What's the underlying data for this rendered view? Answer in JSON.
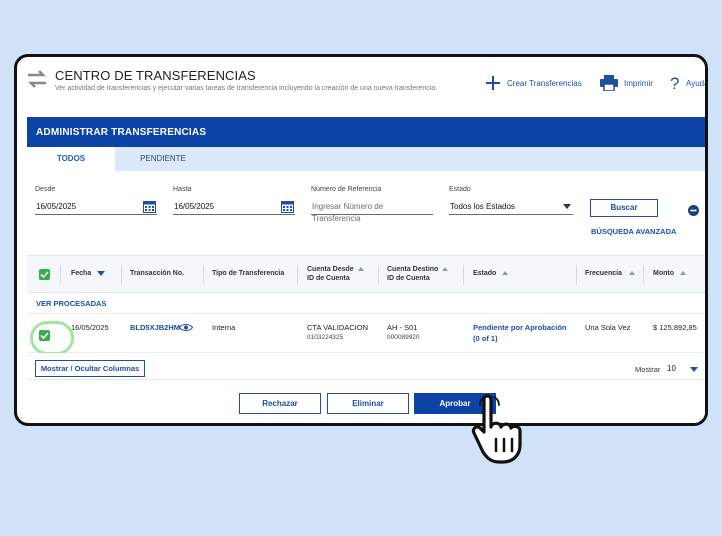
{
  "app": {
    "title": "CENTRO DE TRANSFERENCIAS",
    "subtitle": "Ver actividad de transferencias y ejecutar varias tareas de transferencia incluyendo la creación de una nueva transferencia.",
    "actions": {
      "create": "Crear Transferencias",
      "print": "Imprimir",
      "help": "Ayuda"
    }
  },
  "panel": {
    "title": "ADMINISTRAR TRANSFERENCIAS",
    "tabs": [
      {
        "label": "TODOS",
        "active": true
      },
      {
        "label": "PENDIENTE",
        "active": false
      }
    ]
  },
  "filters": {
    "from": {
      "label": "Desde",
      "value": "16/05/2025"
    },
    "to": {
      "label": "Hasta",
      "value": "16/05/2025"
    },
    "reference": {
      "label": "Número de Referencia",
      "placeholder": "Ingresar Número de Transferencia"
    },
    "status": {
      "label": "Estado",
      "value": "Todos los Estados"
    },
    "search_button": "Buscar",
    "advanced_search": "BÚSQUEDA AVANZADA"
  },
  "table": {
    "headers": {
      "date": "Fecha",
      "transaction": "Transacción No.",
      "type": "Tipo de Transferencia",
      "from_account": "Cuenta Desde",
      "from_account_id": "ID de Cuenta",
      "to_account": "Cuenta Destino",
      "to_account_id": "ID de Cuenta",
      "status": "Estado",
      "frequency": "Frecuencia",
      "amount": "Monto"
    },
    "section_label": "VER PROCESADAS",
    "rows": [
      {
        "date": "16/05/2025",
        "transaction": "BLD5XJB2HM",
        "type": "Interna",
        "from_account": "CTA VALIDACION",
        "from_account_id": "0103224325",
        "to_account": "AH - S01",
        "to_account_id": "000089920",
        "status_line1": "Pendiente por Aprobación",
        "status_line2": "(0 of 1)",
        "frequency": "Una Sola Vez",
        "amount": "$ 125.892,85",
        "checked": true
      }
    ]
  },
  "footer": {
    "columns_button": "Mostrar / Ocultar Columnas",
    "show_label": "Mostrar",
    "show_value": "10"
  },
  "actions": {
    "reject": "Rechazar",
    "delete": "Eliminar",
    "approve": "Aprobar"
  },
  "colors": {
    "primary": "#0b43a6",
    "link": "#1f4fa3",
    "check": "#33b04a",
    "background": "#cfe2f7"
  }
}
